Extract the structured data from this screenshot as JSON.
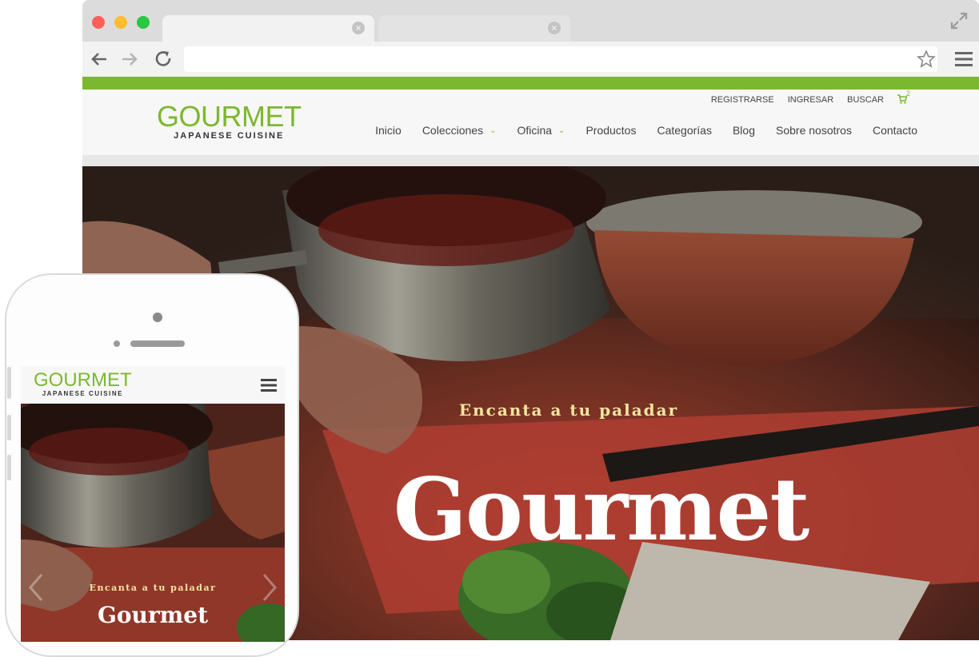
{
  "browser": {
    "tab_close_glyph": "×",
    "url": ""
  },
  "site": {
    "logo_main": "GOURMET",
    "logo_sub": "JAPANESE CUISINE",
    "top_links": [
      "REGISTRARSE",
      "INGRESAR",
      "BUSCAR"
    ],
    "cart_count": "2",
    "nav": [
      {
        "label": "Inicio",
        "dropdown": false
      },
      {
        "label": "Colecciones",
        "dropdown": true
      },
      {
        "label": "Oficina",
        "dropdown": true
      },
      {
        "label": "Productos",
        "dropdown": false
      },
      {
        "label": "Categorías",
        "dropdown": false
      },
      {
        "label": "Blog",
        "dropdown": false
      },
      {
        "label": "Sobre nosotros",
        "dropdown": false
      },
      {
        "label": "Contacto",
        "dropdown": false
      }
    ],
    "hero_tagline": "Encanta a tu paladar",
    "hero_title": "Gourmet"
  },
  "mobile": {
    "logo_main": "GOURMET",
    "logo_sub": "JAPANESE CUISINE",
    "hero_tagline": "Encanta a tu paladar",
    "hero_title": "Gourmet"
  },
  "colors": {
    "accent": "#7cb82f",
    "tagline": "#f3e6a0"
  },
  "icons": {
    "nav_dropdown": "chevron-down-icon",
    "cart": "cart-icon",
    "mobile_menu": "hamburger-icon"
  }
}
